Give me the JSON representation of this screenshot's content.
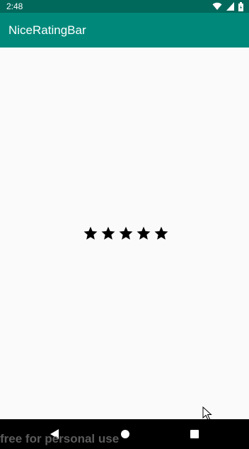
{
  "status_bar": {
    "time": "2:48",
    "icons": [
      "wifi-icon",
      "signal-icon",
      "battery-icon"
    ]
  },
  "app_bar": {
    "title": "NiceRatingBar",
    "color": "#00897B",
    "status_color": "#00695C"
  },
  "rating_bar": {
    "rating": 5,
    "max_rating": 5,
    "star_color": "#000000"
  },
  "nav_bar": {
    "buttons": [
      "back-icon",
      "home-icon",
      "recents-icon"
    ]
  },
  "watermark": {
    "text": "free for personal use"
  }
}
